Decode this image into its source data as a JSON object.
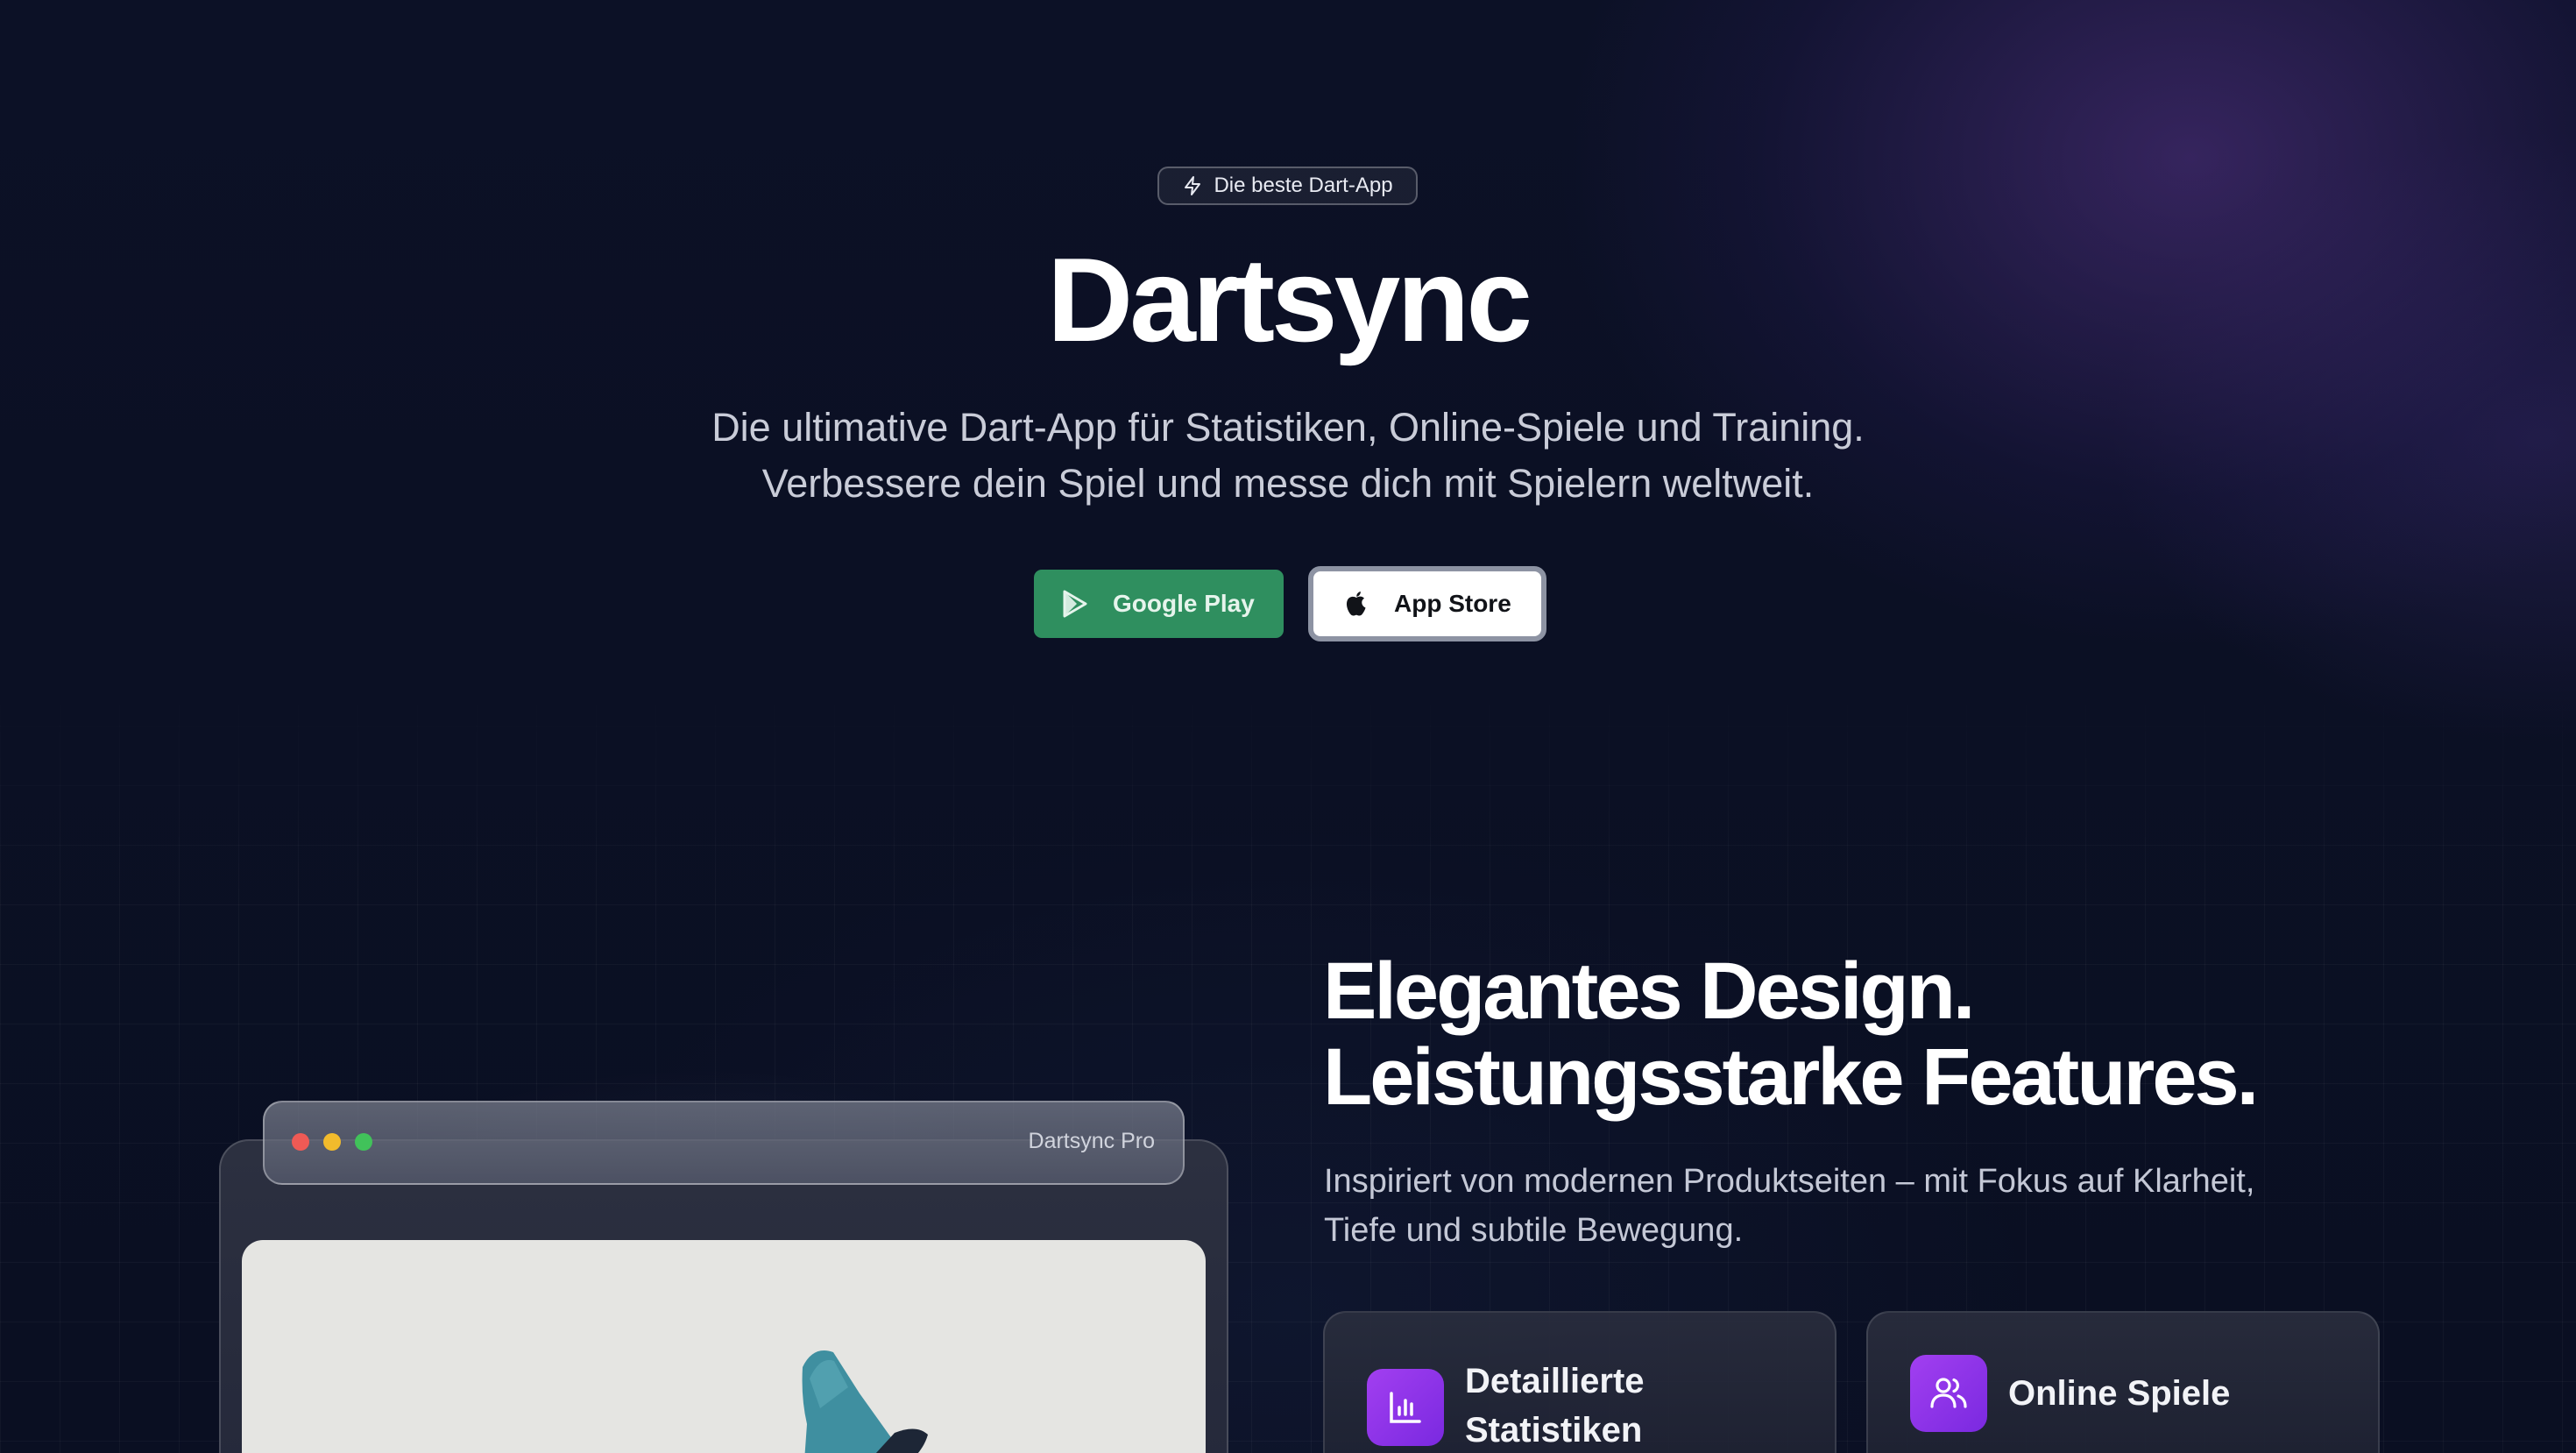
{
  "badge": {
    "label": "Die beste Dart-App",
    "icon": "lightning-icon"
  },
  "hero": {
    "title": "Dartsync",
    "subtitle_line1": "Die ultimative Dart-App für Statistiken, Online-Spiele und Training.",
    "subtitle_line2": "Verbessere dein Spiel und messe dich mit Spielern weltweit."
  },
  "store_buttons": {
    "google": {
      "label": "Google Play",
      "icon": "play-store-icon",
      "color": "#2f8f5f"
    },
    "apple": {
      "label": "App Store",
      "icon": "apple-icon",
      "color": "#ffffff"
    }
  },
  "mockup": {
    "window_title": "Dartsync Pro",
    "window_controls": [
      "close",
      "minimize",
      "maximize"
    ]
  },
  "features": {
    "title_line1": "Elegantes Design.",
    "title_line2": "Leistungsstarke Features.",
    "subtitle_line1": "Inspiriert von modernen Produktseiten – mit Fokus auf Klarheit,",
    "subtitle_line2": "Tiefe und subtile Bewegung.",
    "cards": [
      {
        "label_line1": "Detaillierte",
        "label_line2": "Statistiken",
        "icon": "bar-chart-icon"
      },
      {
        "label": "Online Spiele",
        "icon": "users-icon"
      }
    ],
    "accent": "#9b3ef0"
  }
}
